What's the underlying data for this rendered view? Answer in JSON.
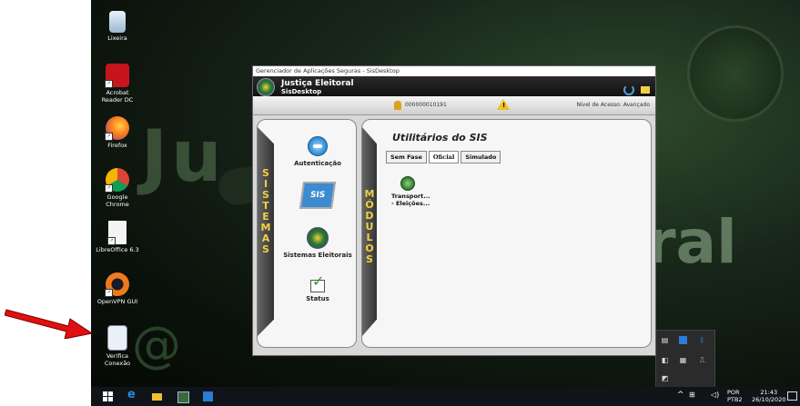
{
  "desktop": {
    "background_words": {
      "left": "Ju",
      "right": "ral"
    },
    "icons": [
      {
        "label": "Lixeira",
        "icon": "recycle-bin-icon"
      },
      {
        "label": "Acrobat Reader DC",
        "icon": "acrobat-icon"
      },
      {
        "label": "Firefox",
        "icon": "firefox-icon"
      },
      {
        "label": "Google Chrome",
        "icon": "chrome-icon"
      },
      {
        "label": "LibreOffice 6.3",
        "icon": "libreoffice-icon"
      },
      {
        "label": "OpenVPN GUI",
        "icon": "openvpn-icon"
      },
      {
        "label": "Verifica Conexão",
        "icon": "verifica-conexao-icon"
      }
    ]
  },
  "window": {
    "title": "Gerenciador de Aplicações Seguras - SisDesktop",
    "brand_line1": "Justiça Eleitoral",
    "brand_line2": "SisDesktop",
    "user_code": "000000010191",
    "access_level": "Nível de Acesso: Avançado",
    "warning_mark": "!"
  },
  "sistemas": {
    "vertical_label": [
      "S",
      "I",
      "S",
      "T",
      "E",
      "M",
      "A",
      "S"
    ],
    "items": [
      {
        "label": "Autenticação",
        "icon": "phone-auth-icon"
      },
      {
        "label": "",
        "icon_text": "SIS",
        "icon": "sis-icon"
      },
      {
        "label": "Sistemas Eleitorais",
        "icon": "electoral-emblem-icon"
      },
      {
        "label": "Status",
        "icon": "status-check-icon"
      }
    ]
  },
  "modulos": {
    "vertical_label": [
      "M",
      "Ó",
      "D",
      "U",
      "L",
      "O",
      "S"
    ],
    "title": "Utilitários do SIS",
    "tabs": [
      {
        "label": "Sem Fase",
        "active": false
      },
      {
        "label": "Oficial",
        "active": true
      },
      {
        "label": "Simulado",
        "active": false
      }
    ],
    "item": {
      "line1": "Transport...",
      "line2": "- Eleições...",
      "icon": "transport-module-icon"
    }
  },
  "taskbar": {
    "language_line1": "POR",
    "language_line2": "PTB2",
    "time": "21:43",
    "date": "26/10/2020"
  },
  "colors": {
    "accent_yellow": "#f0d040",
    "desktop_bg": "#0b120b",
    "arrow_red": "#e01010"
  }
}
